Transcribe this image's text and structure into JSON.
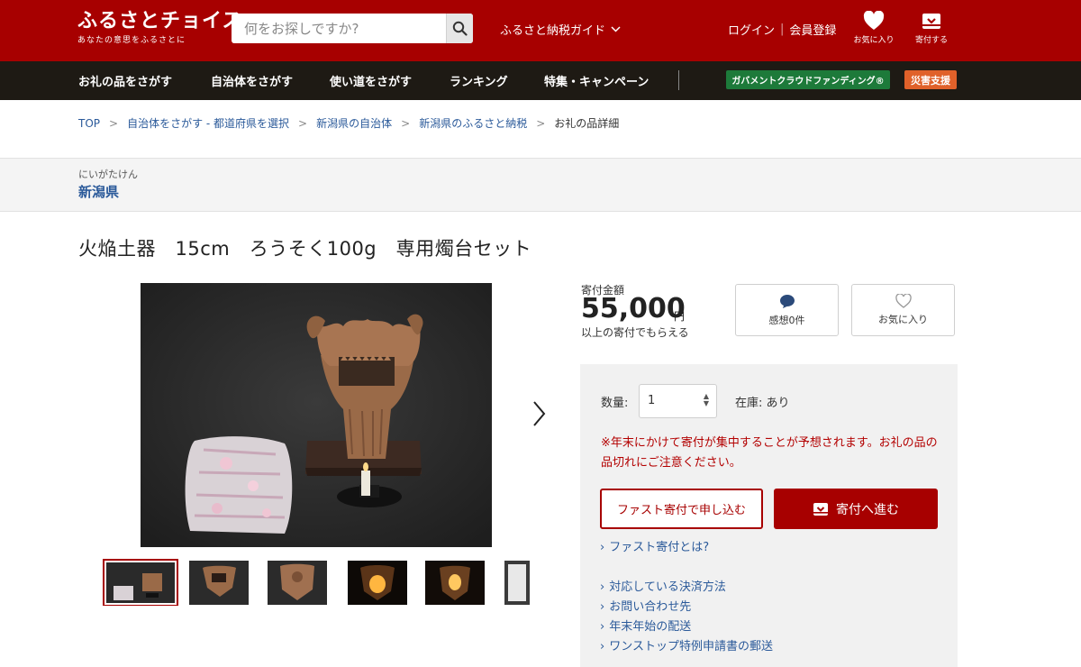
{
  "header": {
    "logo_main": "ふるさとチョイス",
    "logo_sub": "あなたの意思をふるさとに",
    "search_placeholder": "何をお探しですか?",
    "guide_label": "ふるさと納税ガイド",
    "login_label": "ログイン",
    "register_label": "会員登録",
    "favorites_label": "お気に入り",
    "donate_label": "寄付する"
  },
  "nav": {
    "items": [
      "お礼の品をさがす",
      "自治体をさがす",
      "使い道をさがす",
      "ランキング",
      "特集・キャンペーン"
    ],
    "gcf_label": "ガバメントクラウドファンディング®",
    "disaster_label": "災害支援"
  },
  "breadcrumb": [
    "TOP",
    "自治体をさがす - 都道府県を選択",
    "新潟県の自治体",
    "新潟県のふるさと納税",
    "お礼の品詳細"
  ],
  "prefecture": {
    "kana": "にいがたけん",
    "name": "新潟県"
  },
  "product": {
    "title": "火焔土器　15cm　ろうそく100g　専用燭台セット",
    "amount_label": "寄付金額",
    "amount": "55,000",
    "unit": "円",
    "amount_note": "以上の寄付でもらえる",
    "reviews_label": "感想0件",
    "favorite_label": "お気に入り"
  },
  "order": {
    "qty_label": "数量:",
    "qty_value": "1",
    "stock_label": "在庫: あり",
    "notice": "※年末にかけて寄付が集中することが予想されます。お礼の品の品切れにご注意ください。",
    "fast_btn": "ファスト寄付で申し込む",
    "donate_btn": "寄付へ進む",
    "links": [
      "ファスト寄付とは?",
      "対応している決済方法",
      "お問い合わせ先",
      "年末年始の配送",
      "ワンストップ特例申請書の郵送"
    ]
  },
  "colors": {
    "brand": "#a70000",
    "nav_bg": "#1e1a14",
    "gcf": "#1d7a3a",
    "disaster": "#e0612a",
    "link": "#2b5a9a"
  }
}
